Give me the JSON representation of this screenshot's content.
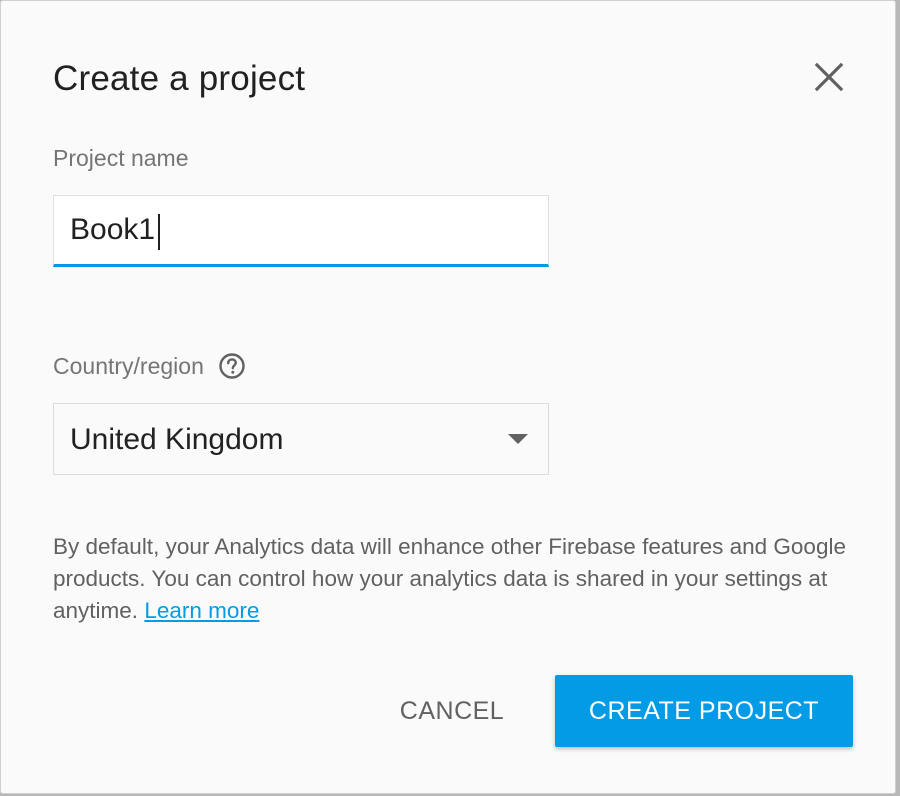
{
  "dialog": {
    "title": "Create a project",
    "close_icon": "close-icon"
  },
  "project_name": {
    "label": "Project name",
    "value": "Book1",
    "focused": true,
    "accent_color": "#039be5"
  },
  "country": {
    "label": "Country/region",
    "help_icon": "help-circle-icon",
    "selected": "United Kingdom",
    "dropdown_icon": "dropdown-arrow-icon"
  },
  "info": {
    "text": "By default, your Analytics data will enhance other Firebase features and Google products. You can control how your analytics data is shared in your settings at anytime.",
    "link_label": "Learn more",
    "link_color": "#039be5"
  },
  "actions": {
    "cancel_label": "CANCEL",
    "create_label": "CREATE PROJECT",
    "primary_color": "#039be5"
  }
}
